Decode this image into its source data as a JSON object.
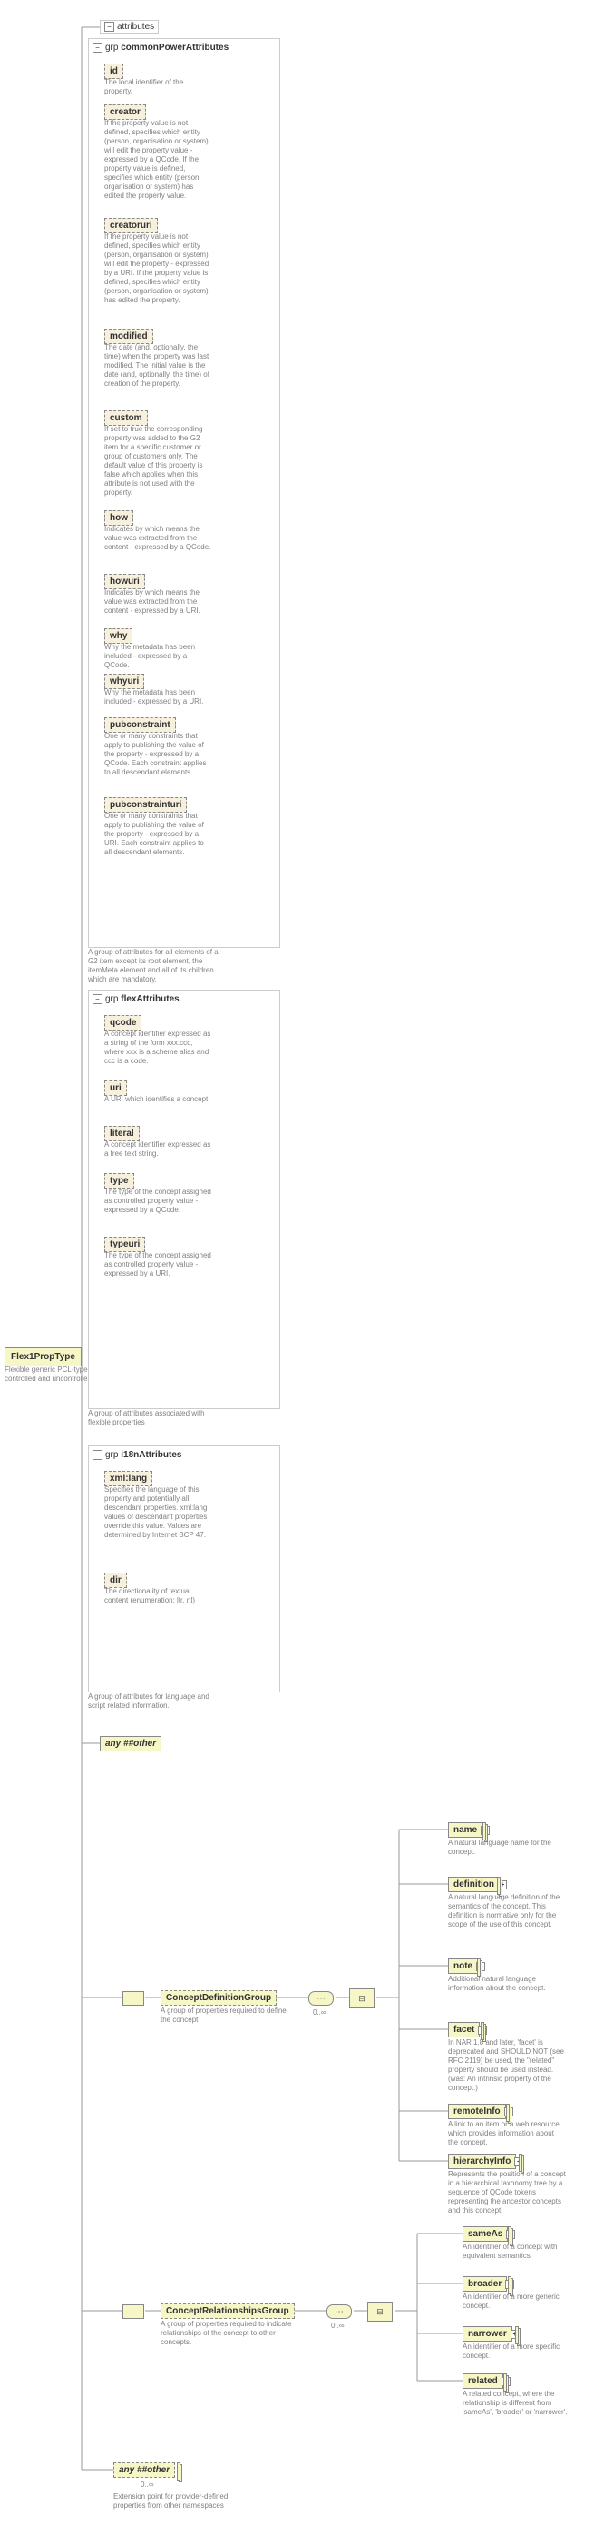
{
  "root": {
    "name": "Flex1PropType",
    "note": "Flexible generic PCL-type for both controlled and uncontrolled values"
  },
  "attributes_label": "attributes",
  "groups": {
    "common": {
      "title_prefix": "grp ",
      "title": "commonPowerAttributes",
      "note": "A group of attributes for all elements of a G2 item except its root element, the itemMeta element and all of its children which are mandatory.",
      "attrs": [
        {
          "name": "id",
          "note": "The local identifier of the property."
        },
        {
          "name": "creator",
          "note": "If the property value is not defined, specifies which entity (person, organisation or system) will edit the property value - expressed by a QCode. If the property value is defined, specifies which entity (person, organisation or system) has edited the property value."
        },
        {
          "name": "creatoruri",
          "note": "If the property value is not defined, specifies which entity (person, organisation or system) will edit the property - expressed by a URI. If the property value is defined, specifies which entity (person, organisation or system) has edited the property."
        },
        {
          "name": "modified",
          "note": "The date (and, optionally, the time) when the property was last modified. The initial value is the date (and, optionally, the time) of creation of the property."
        },
        {
          "name": "custom",
          "note": "If set to true the corresponding property was added to the G2 item for a specific customer or group of customers only. The default value of this property is false which applies when this attribute is not used with the property."
        },
        {
          "name": "how",
          "note": "Indicates by which means the value was extracted from the content - expressed by a QCode."
        },
        {
          "name": "howuri",
          "note": "Indicates by which means the value was extracted from the content - expressed by a URI."
        },
        {
          "name": "why",
          "note": "Why the metadata has been included - expressed by a QCode."
        },
        {
          "name": "whyuri",
          "note": "Why the metadata has been included - expressed by a URI."
        },
        {
          "name": "pubconstraint",
          "note": "One or many constraints that apply to publishing the value of the property - expressed by a QCode. Each constraint applies to all descendant elements."
        },
        {
          "name": "pubconstrainturi",
          "note": "One or many constraints that apply to publishing the value of the property - expressed by a URI. Each constraint applies to all descendant elements."
        }
      ]
    },
    "flex": {
      "title_prefix": "grp ",
      "title": "flexAttributes",
      "note": "A group of attributes associated with flexible properties",
      "attrs": [
        {
          "name": "qcode",
          "note": "A concept identifier expressed as a string of the form xxx:ccc, where xxx is a scheme alias and ccc is a code."
        },
        {
          "name": "uri",
          "note": "A URI which identifies a concept."
        },
        {
          "name": "literal",
          "note": "A concept identifier expressed as a free text string."
        },
        {
          "name": "type",
          "note": "The type of the concept assigned as controlled property value - expressed by a QCode."
        },
        {
          "name": "typeuri",
          "note": "The type of the concept assigned as controlled property value - expressed by a URI."
        }
      ]
    },
    "i18n": {
      "title_prefix": "grp ",
      "title": "i18nAttributes",
      "note": "A group of attributes for language and script related information.",
      "attrs": [
        {
          "name": "xml:lang",
          "note": "Specifies the language of this property and potentially all descendant properties. xml:lang values of descendant properties override this value. Values are determined by Internet BCP 47."
        },
        {
          "name": "dir",
          "note": "The directionality of textual content (enumeration: ltr, rtl)"
        }
      ]
    }
  },
  "any_other": {
    "label": "any ##other"
  },
  "conceptDef": {
    "name": "ConceptDefinitionGroup",
    "note": "A group of properties required to define the concept",
    "children": [
      {
        "name": "name",
        "note": "A natural language name for the concept."
      },
      {
        "name": "definition",
        "note": "A natural language definition of the semantics of the concept. This definition is normative only for the scope of the use of this concept."
      },
      {
        "name": "note",
        "note": "Additional natural language information about the concept."
      },
      {
        "name": "facet",
        "note": "In NAR 1.8 and later, 'facet' is deprecated and SHOULD NOT (see RFC 2119) be used, the \"related\" property should be used instead. (was: An intrinsic property of the concept.)"
      },
      {
        "name": "remoteInfo",
        "note": "A link to an item or a web resource which provides information about the concept."
      },
      {
        "name": "hierarchyInfo",
        "note": "Represents the position of a concept in a hierarchical taxonomy tree by a sequence of QCode tokens representing the ancestor concepts and this concept."
      }
    ],
    "range": "0..∞"
  },
  "conceptRel": {
    "name": "ConceptRelationshipsGroup",
    "note": "A group of properties required to indicate relationships of the concept to other concepts.",
    "children": [
      {
        "name": "sameAs",
        "note": "An identifier of a concept with equivalent semantics."
      },
      {
        "name": "broader",
        "note": "An identifier of a more generic concept."
      },
      {
        "name": "narrower",
        "note": "An identifier of a more specific concept."
      },
      {
        "name": "related",
        "note": "A related concept, where the relationship is different from 'sameAs', 'broader' or 'narrower'."
      }
    ],
    "range": "0..∞"
  },
  "any_other2": {
    "label": "any ##other",
    "range": "0..∞",
    "note": "Extension point for provider-defined properties from other namespaces"
  }
}
